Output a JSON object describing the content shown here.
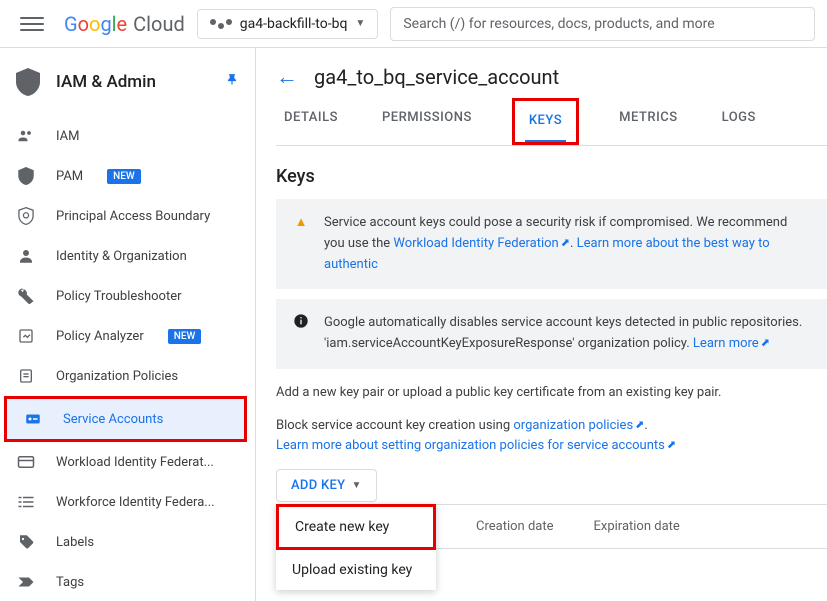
{
  "header": {
    "logo_text": "Google",
    "logo_suffix": "Cloud",
    "project_name": "ga4-backfill-to-bq",
    "search_placeholder": "Search (/) for resources, docs, products, and more"
  },
  "sidebar": {
    "title": "IAM & Admin",
    "items": [
      {
        "label": "IAM",
        "icon": "people"
      },
      {
        "label": "PAM",
        "icon": "shield",
        "badge": "NEW"
      },
      {
        "label": "Principal Access Boundary",
        "icon": "boundary"
      },
      {
        "label": "Identity & Organization",
        "icon": "person"
      },
      {
        "label": "Policy Troubleshooter",
        "icon": "wrench"
      },
      {
        "label": "Policy Analyzer",
        "icon": "analyzer",
        "badge": "NEW"
      },
      {
        "label": "Organization Policies",
        "icon": "doc"
      },
      {
        "label": "Service Accounts",
        "icon": "key",
        "active": true
      },
      {
        "label": "Workload Identity Federat...",
        "icon": "card"
      },
      {
        "label": "Workforce Identity Federa...",
        "icon": "list"
      },
      {
        "label": "Labels",
        "icon": "tag"
      },
      {
        "label": "Tags",
        "icon": "arrow"
      }
    ]
  },
  "main": {
    "page_title": "ga4_to_bq_service_account",
    "tabs": [
      {
        "label": "DETAILS"
      },
      {
        "label": "PERMISSIONS"
      },
      {
        "label": "KEYS",
        "active": true
      },
      {
        "label": "METRICS"
      },
      {
        "label": "LOGS"
      }
    ],
    "section_title": "Keys",
    "warning": {
      "text_prefix": "Service account keys could pose a security risk if compromised. We recommend you use the ",
      "link1": "Workload Identity Federation",
      "text_mid": ". ",
      "link2": "Learn more about the best way to authentic"
    },
    "info": {
      "line1": "Google automatically disables service account keys detected in public repositories.",
      "line2_prefix": "'iam.serviceAccountKeyExposureResponse' organization policy. ",
      "link": "Learn more"
    },
    "add_key_desc": "Add a new key pair or upload a public key certificate from an existing key pair.",
    "block_desc_prefix": "Block service account key creation using ",
    "block_link1": "organization policies",
    "block_desc_suffix": ".",
    "block_link2": "Learn more about setting organization policies for service accounts",
    "add_key_button": "ADD KEY",
    "dropdown": {
      "create": "Create new key",
      "upload": "Upload existing key"
    },
    "table_headers": {
      "creation": "Creation date",
      "expiration": "Expiration date"
    }
  }
}
